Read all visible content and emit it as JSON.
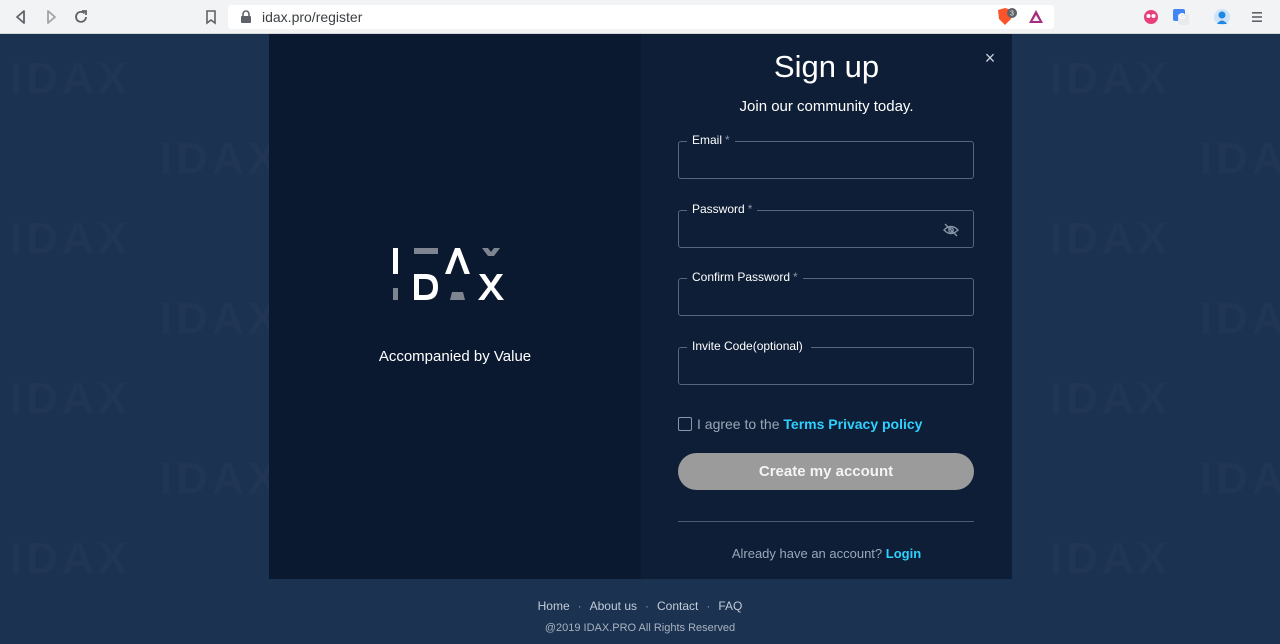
{
  "browser": {
    "url": "idax.pro/register",
    "icons": [
      "back-icon",
      "forward-icon",
      "reload-icon",
      "bookmark-icon",
      "lock-icon",
      "brave-shield-icon",
      "brave-rewards-icon",
      "extension-icon",
      "translate-icon",
      "profile-icon",
      "menu-icon"
    ],
    "shield_count": "3"
  },
  "brand": {
    "logo_text": "IDAX",
    "tagline": "Accompanied by Value"
  },
  "signup": {
    "title": "Sign up",
    "subtitle": "Join our community today.",
    "close_icon": "×",
    "fields": [
      {
        "label": "Email",
        "required": "*",
        "value": ""
      },
      {
        "label": "Password",
        "required": "*",
        "value": ""
      },
      {
        "label": "Confirm Password",
        "required": "*",
        "value": ""
      },
      {
        "label": "Invite Code(optional)",
        "required": "",
        "value": ""
      }
    ],
    "agree_prefix": "I agree to the",
    "terms_link": "Terms",
    "privacy_link": "Privacy policy",
    "create_button": "Create my account",
    "login_prompt": "Already have an account?",
    "login_link": "Login"
  },
  "footer": {
    "links": [
      "Home",
      "About us",
      "Contact",
      "FAQ"
    ],
    "copyright": "@2019 IDAX.PRO All Rights Reserved"
  },
  "colors": {
    "page_bg": "#1b3250",
    "modal_left": "#0b1930",
    "modal_right": "#0d1e36",
    "accent": "#2fd0ff",
    "button_disabled": "#9b9b9b"
  }
}
